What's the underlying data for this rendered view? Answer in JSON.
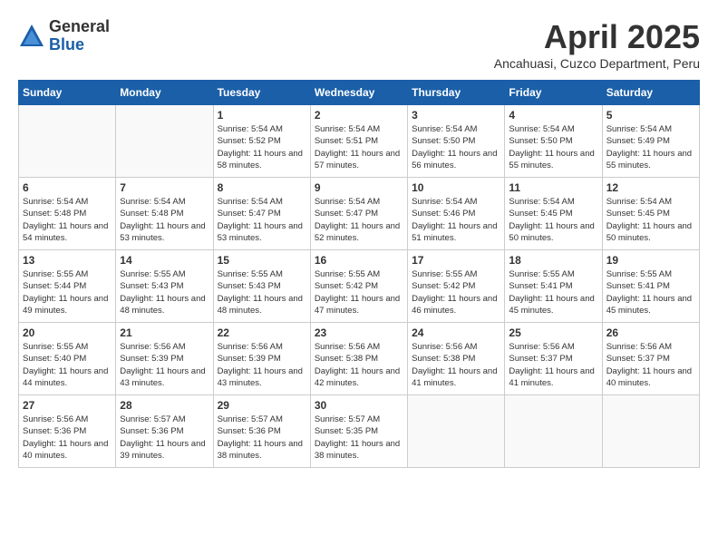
{
  "header": {
    "logo": {
      "general": "General",
      "blue": "Blue"
    },
    "title": "April 2025",
    "location": "Ancahuasi, Cuzco Department, Peru"
  },
  "calendar": {
    "days_of_week": [
      "Sunday",
      "Monday",
      "Tuesday",
      "Wednesday",
      "Thursday",
      "Friday",
      "Saturday"
    ],
    "weeks": [
      {
        "days": [
          {
            "number": "",
            "info": ""
          },
          {
            "number": "",
            "info": ""
          },
          {
            "number": "1",
            "info": "Sunrise: 5:54 AM\nSunset: 5:52 PM\nDaylight: 11 hours and 58 minutes."
          },
          {
            "number": "2",
            "info": "Sunrise: 5:54 AM\nSunset: 5:51 PM\nDaylight: 11 hours and 57 minutes."
          },
          {
            "number": "3",
            "info": "Sunrise: 5:54 AM\nSunset: 5:50 PM\nDaylight: 11 hours and 56 minutes."
          },
          {
            "number": "4",
            "info": "Sunrise: 5:54 AM\nSunset: 5:50 PM\nDaylight: 11 hours and 55 minutes."
          },
          {
            "number": "5",
            "info": "Sunrise: 5:54 AM\nSunset: 5:49 PM\nDaylight: 11 hours and 55 minutes."
          }
        ]
      },
      {
        "days": [
          {
            "number": "6",
            "info": "Sunrise: 5:54 AM\nSunset: 5:48 PM\nDaylight: 11 hours and 54 minutes."
          },
          {
            "number": "7",
            "info": "Sunrise: 5:54 AM\nSunset: 5:48 PM\nDaylight: 11 hours and 53 minutes."
          },
          {
            "number": "8",
            "info": "Sunrise: 5:54 AM\nSunset: 5:47 PM\nDaylight: 11 hours and 53 minutes."
          },
          {
            "number": "9",
            "info": "Sunrise: 5:54 AM\nSunset: 5:47 PM\nDaylight: 11 hours and 52 minutes."
          },
          {
            "number": "10",
            "info": "Sunrise: 5:54 AM\nSunset: 5:46 PM\nDaylight: 11 hours and 51 minutes."
          },
          {
            "number": "11",
            "info": "Sunrise: 5:54 AM\nSunset: 5:45 PM\nDaylight: 11 hours and 50 minutes."
          },
          {
            "number": "12",
            "info": "Sunrise: 5:54 AM\nSunset: 5:45 PM\nDaylight: 11 hours and 50 minutes."
          }
        ]
      },
      {
        "days": [
          {
            "number": "13",
            "info": "Sunrise: 5:55 AM\nSunset: 5:44 PM\nDaylight: 11 hours and 49 minutes."
          },
          {
            "number": "14",
            "info": "Sunrise: 5:55 AM\nSunset: 5:43 PM\nDaylight: 11 hours and 48 minutes."
          },
          {
            "number": "15",
            "info": "Sunrise: 5:55 AM\nSunset: 5:43 PM\nDaylight: 11 hours and 48 minutes."
          },
          {
            "number": "16",
            "info": "Sunrise: 5:55 AM\nSunset: 5:42 PM\nDaylight: 11 hours and 47 minutes."
          },
          {
            "number": "17",
            "info": "Sunrise: 5:55 AM\nSunset: 5:42 PM\nDaylight: 11 hours and 46 minutes."
          },
          {
            "number": "18",
            "info": "Sunrise: 5:55 AM\nSunset: 5:41 PM\nDaylight: 11 hours and 45 minutes."
          },
          {
            "number": "19",
            "info": "Sunrise: 5:55 AM\nSunset: 5:41 PM\nDaylight: 11 hours and 45 minutes."
          }
        ]
      },
      {
        "days": [
          {
            "number": "20",
            "info": "Sunrise: 5:55 AM\nSunset: 5:40 PM\nDaylight: 11 hours and 44 minutes."
          },
          {
            "number": "21",
            "info": "Sunrise: 5:56 AM\nSunset: 5:39 PM\nDaylight: 11 hours and 43 minutes."
          },
          {
            "number": "22",
            "info": "Sunrise: 5:56 AM\nSunset: 5:39 PM\nDaylight: 11 hours and 43 minutes."
          },
          {
            "number": "23",
            "info": "Sunrise: 5:56 AM\nSunset: 5:38 PM\nDaylight: 11 hours and 42 minutes."
          },
          {
            "number": "24",
            "info": "Sunrise: 5:56 AM\nSunset: 5:38 PM\nDaylight: 11 hours and 41 minutes."
          },
          {
            "number": "25",
            "info": "Sunrise: 5:56 AM\nSunset: 5:37 PM\nDaylight: 11 hours and 41 minutes."
          },
          {
            "number": "26",
            "info": "Sunrise: 5:56 AM\nSunset: 5:37 PM\nDaylight: 11 hours and 40 minutes."
          }
        ]
      },
      {
        "days": [
          {
            "number": "27",
            "info": "Sunrise: 5:56 AM\nSunset: 5:36 PM\nDaylight: 11 hours and 40 minutes."
          },
          {
            "number": "28",
            "info": "Sunrise: 5:57 AM\nSunset: 5:36 PM\nDaylight: 11 hours and 39 minutes."
          },
          {
            "number": "29",
            "info": "Sunrise: 5:57 AM\nSunset: 5:36 PM\nDaylight: 11 hours and 38 minutes."
          },
          {
            "number": "30",
            "info": "Sunrise: 5:57 AM\nSunset: 5:35 PM\nDaylight: 11 hours and 38 minutes."
          },
          {
            "number": "",
            "info": ""
          },
          {
            "number": "",
            "info": ""
          },
          {
            "number": "",
            "info": ""
          }
        ]
      }
    ]
  }
}
